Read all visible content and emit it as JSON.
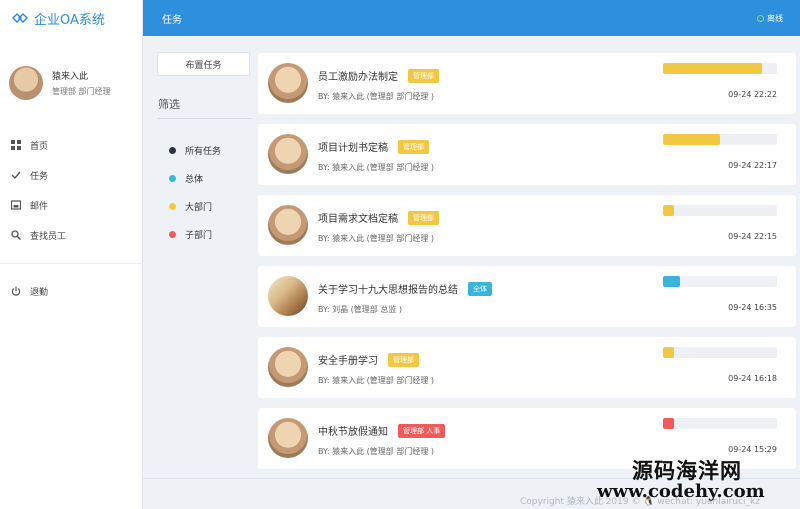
{
  "app": {
    "brand": "企业OA系统"
  },
  "user": {
    "name": "猿来入此",
    "role": "管理部 部门经理"
  },
  "nav": [
    {
      "label": "首页",
      "icon": "dashboard-icon"
    },
    {
      "label": "任务",
      "icon": "check-icon"
    },
    {
      "label": "邮件",
      "icon": "mail-icon"
    },
    {
      "label": "查找员工",
      "icon": "search-icon"
    }
  ],
  "logout": {
    "label": "退勤",
    "icon": "power-icon"
  },
  "header": {
    "title": "任务",
    "status": "离线"
  },
  "filter": {
    "assign_button": "布置任务",
    "title": "筛选",
    "items": [
      {
        "label": "所有任务",
        "color": "#2b3440"
      },
      {
        "label": "总体",
        "color": "#3bb4dc"
      },
      {
        "label": "大部门",
        "color": "#f2c744"
      },
      {
        "label": "子部门",
        "color": "#ef5a5a"
      }
    ]
  },
  "tasks": [
    {
      "title": "员工激励办法制定",
      "badge": "管理部",
      "badge_color": "#f2c744",
      "by": "BY: 猿来入此 (管理部 部门经理 )",
      "progress": 0.87,
      "bar_color": "#f2c744",
      "time": "09-24 22:22",
      "avatar": "user-avatar"
    },
    {
      "title": "项目计划书定稿",
      "badge": "管理部",
      "badge_color": "#f2c744",
      "by": "BY: 猿来入此 (管理部 部门经理 )",
      "progress": 0.5,
      "bar_color": "#f2c744",
      "time": "09-24 22:17",
      "avatar": "user-avatar"
    },
    {
      "title": "项目需求文档定稿",
      "badge": "管理部",
      "badge_color": "#f2c744",
      "by": "BY: 猿来入此 (管理部 部门经理 )",
      "progress": 0.1,
      "bar_color": "#f2c744",
      "time": "09-24 22:15",
      "avatar": "user-avatar"
    },
    {
      "title": "关于学习十九大思想报告的总结",
      "badge": "全体",
      "badge_color": "#3bb4dc",
      "by": "BY: 刘晶 (管理部 总监 )",
      "progress": 0.15,
      "bar_color": "#3bb4dc",
      "time": "09-24 16:35",
      "avatar": "photo-avatar"
    },
    {
      "title": "安全手册学习",
      "badge": "管理部",
      "badge_color": "#f2c744",
      "by": "BY: 猿来入此 (管理部 部门经理 )",
      "progress": 0.1,
      "bar_color": "#f2c744",
      "time": "09-24 16:18",
      "avatar": "user-avatar"
    },
    {
      "title": "中秋节放假通知",
      "badge": "管理部 人事",
      "badge_color": "#ef5a5a",
      "by": "BY: 猿来入此 (管理部 部门经理 )",
      "progress": 0.1,
      "bar_color": "#ef5a5a",
      "time": "09-24 15:29",
      "avatar": "user-avatar"
    }
  ],
  "footer": {
    "copyright": "Copyright 猿来入此 2019 © 🐧 wechat: yuanlairuci_kz"
  },
  "watermark": {
    "line1": "源码海洋网",
    "line2": "www.codehy.com"
  }
}
